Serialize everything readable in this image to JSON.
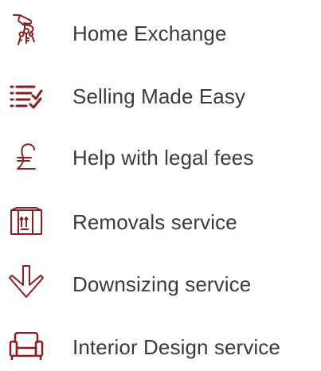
{
  "accent_color": "#8b1e1e",
  "services": [
    {
      "label": "Home Exchange",
      "icon": "hand-keys-icon"
    },
    {
      "label": "Selling Made Easy",
      "icon": "checklist-icon"
    },
    {
      "label": "Help with legal fees",
      "icon": "pound-sign-icon"
    },
    {
      "label": "Removals service",
      "icon": "moving-box-icon"
    },
    {
      "label": "Downsizing service",
      "icon": "down-arrow-icon"
    },
    {
      "label": "Interior Design service",
      "icon": "armchair-icon"
    }
  ]
}
